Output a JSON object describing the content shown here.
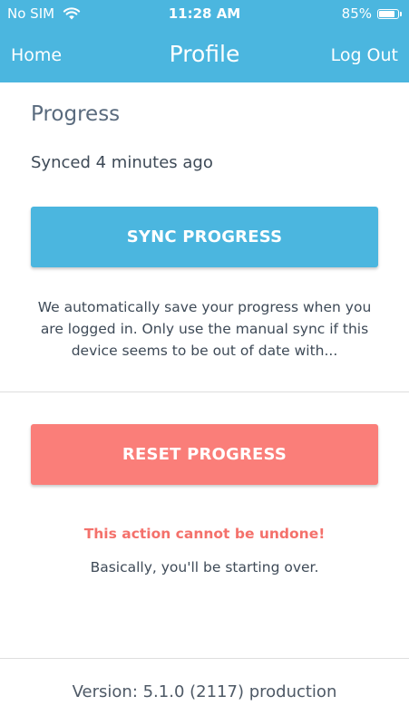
{
  "status_bar": {
    "carrier": "No SIM",
    "time": "11:28 AM",
    "battery_text": "85%",
    "battery_level": 0.85
  },
  "nav": {
    "left": "Home",
    "title": "Profile",
    "right": "Log Out"
  },
  "progress": {
    "title": "Progress",
    "sync_status": "Synced 4 minutes ago",
    "sync_button": "SYNC PROGRESS",
    "sync_note": "We automatically save your progress when you are logged in. Only use the manual sync if this device seems to be out of date with..."
  },
  "reset": {
    "button": "RESET PROGRESS",
    "warning": "This action cannot be undone!",
    "note": "Basically, you'll be starting over."
  },
  "footer": {
    "version": "Version: 5.1.0 (2117) production"
  },
  "colors": {
    "primary": "#4bb6df",
    "danger": "#fa7e79",
    "warning_text": "#f4716b"
  },
  "icons": [
    "wifi-icon",
    "battery-icon"
  ]
}
